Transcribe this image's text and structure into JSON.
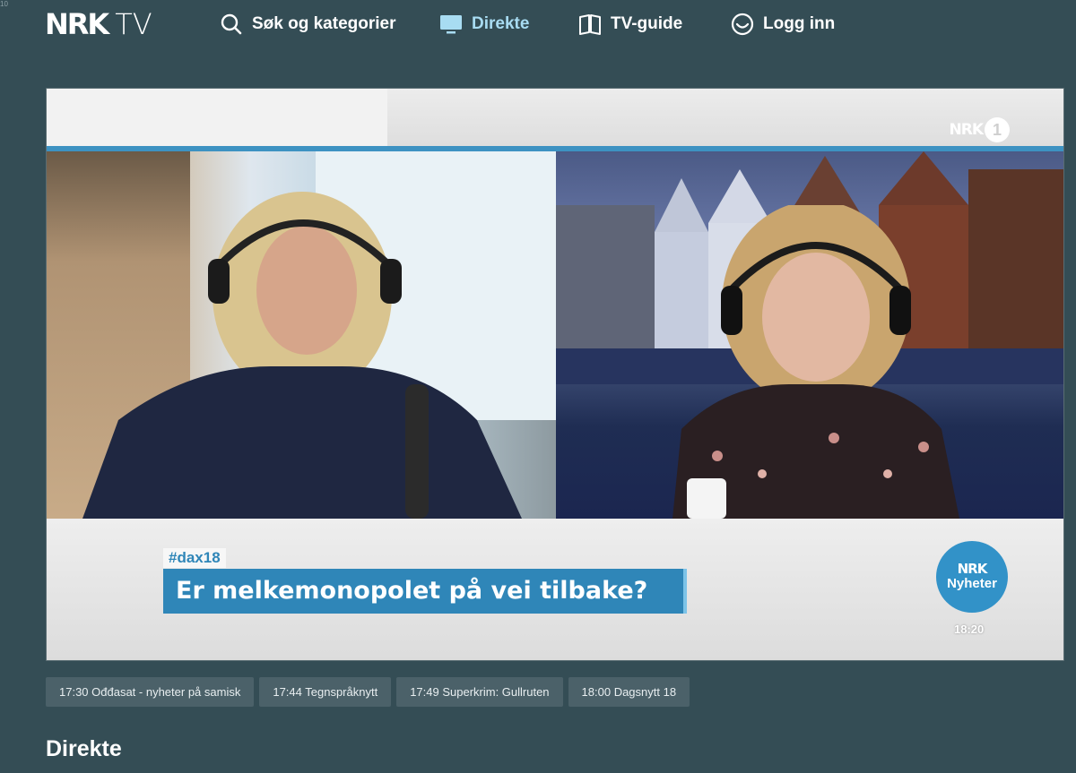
{
  "corner_mark": "10",
  "header": {
    "logo_nrk": "NRK",
    "logo_tv": "TV",
    "nav": {
      "search": "Søk og kategorier",
      "direkte": "Direkte",
      "guide": "TV-guide",
      "login": "Logg inn"
    },
    "active_color": "#a8dcf2"
  },
  "player": {
    "channel_logo": "NRK",
    "channel_number": "1",
    "hashtag": "#dax18",
    "headline": "Er melkemonopolet på vei tilbake?",
    "bug_line1": "NRK",
    "bug_line2": "Nyheter",
    "clock": "18:20",
    "accent": "#2f86b8"
  },
  "schedule": [
    {
      "label": "17:30 Ođđasat - nyheter på samisk"
    },
    {
      "label": "17:44 Tegnspråknytt"
    },
    {
      "label": "17:49 Superkrim: Gullruten"
    },
    {
      "label": "18:00 Dagsnytt 18"
    }
  ],
  "section_title": "Direkte"
}
